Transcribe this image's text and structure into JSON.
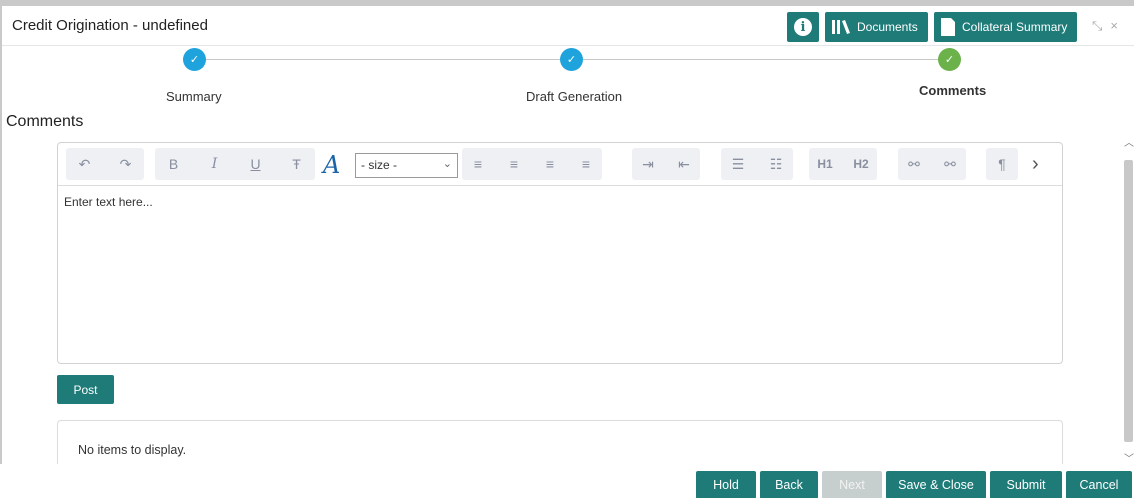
{
  "window": {
    "title": "Credit Origination - undefined"
  },
  "header_buttons": {
    "documents": "Documents",
    "collateral_summary": "Collateral Summary",
    "info": "i"
  },
  "window_controls": {
    "minimize": "⤡",
    "close": "×"
  },
  "stepper": {
    "steps": [
      {
        "label": "Summary",
        "status": "completed",
        "color": "#1fa3dd"
      },
      {
        "label": "Draft Generation",
        "status": "completed",
        "color": "#1fa3dd"
      },
      {
        "label": "Comments",
        "status": "current",
        "color": "#6bb24a"
      }
    ],
    "check": "✓"
  },
  "comments": {
    "title": "Comments",
    "size_select": {
      "selected": "- size -"
    },
    "placeholder": "Enter text here...",
    "post_label": "Post",
    "empty_list": "No items to display."
  },
  "toolbar": {
    "undo": "↶",
    "redo": "↷",
    "bold": "B",
    "italic": "I",
    "underline": "U",
    "strike": "Ŧ",
    "font": "A",
    "align_left": "≡",
    "align_center": "≡",
    "align_right": "≡",
    "justify": "≡",
    "indent": "⇥",
    "outdent": "⇤",
    "bullets": "☰",
    "numbers": "☷",
    "h1": "H1",
    "h2": "H2",
    "link": "⚯",
    "unlink": "⚯",
    "paragraph": "¶",
    "more": "›"
  },
  "footer": {
    "buttons": [
      {
        "label": "Hold",
        "enabled": true
      },
      {
        "label": "Back",
        "enabled": true
      },
      {
        "label": "Next",
        "enabled": false
      },
      {
        "label": "Save & Close",
        "enabled": true
      },
      {
        "label": "Submit",
        "enabled": true
      },
      {
        "label": "Cancel",
        "enabled": true
      }
    ]
  },
  "colors": {
    "accent": "#1e7b78",
    "step_blue": "#1fa3dd",
    "step_green": "#6bb24a"
  }
}
